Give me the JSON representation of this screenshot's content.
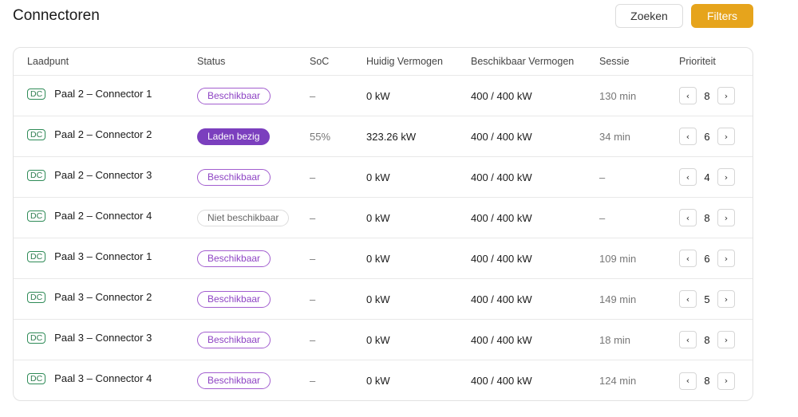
{
  "header": {
    "title": "Connectoren",
    "search_label": "Zoeken",
    "filters_label": "Filters"
  },
  "colors": {
    "accent": "#e6a41c",
    "status_available": "#8e44c4",
    "status_charging": "#7b3fbe",
    "dc_badge": "#2e7d4f"
  },
  "table": {
    "columns": {
      "point": "Laadpunt",
      "status": "Status",
      "soc": "SoC",
      "power": "Huidig Vermogen",
      "available": "Beschikbaar Vermogen",
      "session": "Sessie",
      "priority": "Prioriteit"
    },
    "prev_icon": "‹",
    "next_icon": "›",
    "rows": [
      {
        "type": "DC",
        "name": "Paal 2 – Connector 1",
        "status": "Beschikbaar",
        "status_kind": "available",
        "soc": "–",
        "power": "0 kW",
        "available": "400 / 400 kW",
        "session": "130 min",
        "priority": "8"
      },
      {
        "type": "DC",
        "name": "Paal 2 – Connector 2",
        "status": "Laden bezig",
        "status_kind": "charging",
        "soc": "55%",
        "power": "323.26 kW",
        "available": "400 / 400 kW",
        "session": "34 min",
        "priority": "6"
      },
      {
        "type": "DC",
        "name": "Paal 2 – Connector 3",
        "status": "Beschikbaar",
        "status_kind": "available",
        "soc": "–",
        "power": "0 kW",
        "available": "400 / 400 kW",
        "session": "–",
        "priority": "4"
      },
      {
        "type": "DC",
        "name": "Paal 2 – Connector 4",
        "status": "Niet beschikbaar",
        "status_kind": "unavailable",
        "soc": "–",
        "power": "0 kW",
        "available": "400 / 400 kW",
        "session": "–",
        "priority": "8"
      },
      {
        "type": "DC",
        "name": "Paal 3 – Connector 1",
        "status": "Beschikbaar",
        "status_kind": "available",
        "soc": "–",
        "power": "0 kW",
        "available": "400 / 400 kW",
        "session": "109 min",
        "priority": "6"
      },
      {
        "type": "DC",
        "name": "Paal 3 – Connector 2",
        "status": "Beschikbaar",
        "status_kind": "available",
        "soc": "–",
        "power": "0 kW",
        "available": "400 / 400 kW",
        "session": "149 min",
        "priority": "5"
      },
      {
        "type": "DC",
        "name": "Paal 3 – Connector 3",
        "status": "Beschikbaar",
        "status_kind": "available",
        "soc": "–",
        "power": "0 kW",
        "available": "400 / 400 kW",
        "session": "18 min",
        "priority": "8"
      },
      {
        "type": "DC",
        "name": "Paal 3 – Connector 4",
        "status": "Beschikbaar",
        "status_kind": "available",
        "soc": "–",
        "power": "0 kW",
        "available": "400 / 400 kW",
        "session": "124 min",
        "priority": "8"
      }
    ]
  }
}
